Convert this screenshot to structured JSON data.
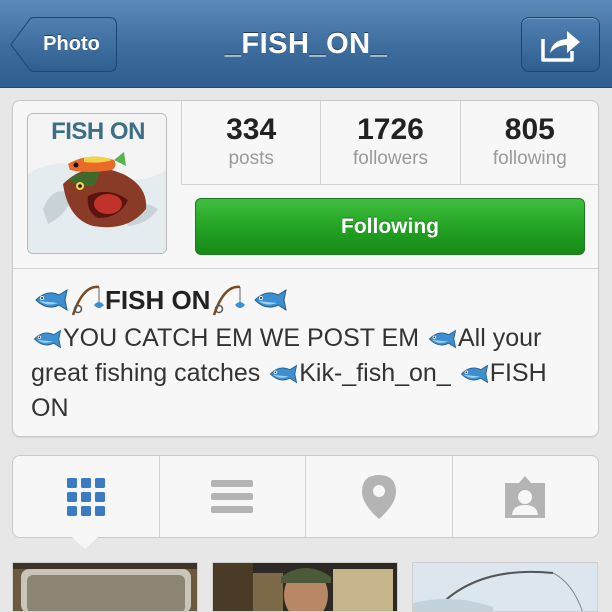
{
  "navbar": {
    "back_label": "Photo",
    "title": "_FISH_ON_",
    "share_icon": "share-arrow-icon"
  },
  "profile": {
    "avatar_text": "FISH ON",
    "stats": [
      {
        "value": "334",
        "label": "posts"
      },
      {
        "value": "1726",
        "label": "followers"
      },
      {
        "value": "805",
        "label": "following"
      }
    ],
    "follow_button": "Following",
    "name": "FISH ON",
    "bio_segments": [
      "YOU CATCH EM WE POST EM ",
      "All your great fishing catches ",
      "Kik-_fish_on_ ",
      "FISH ON"
    ]
  },
  "tabs": [
    {
      "name": "grid",
      "icon": "grid-icon",
      "active": true
    },
    {
      "name": "list",
      "icon": "list-icon",
      "active": false
    },
    {
      "name": "map",
      "icon": "map-pin-icon",
      "active": false
    },
    {
      "name": "tagged",
      "icon": "tagged-user-icon",
      "active": false
    }
  ],
  "colors": {
    "nav_blue": "#3f6f9f",
    "follow_green": "#22a022",
    "active_tab_blue": "#3a7bc4",
    "inactive_tab_gray": "#b4b4b4"
  }
}
